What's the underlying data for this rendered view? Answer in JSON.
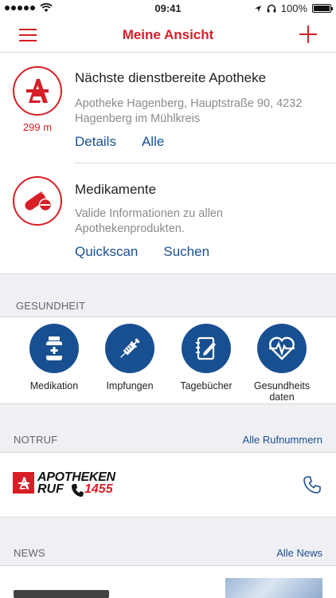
{
  "status_bar": {
    "time": "09:41",
    "battery": "100%"
  },
  "navbar": {
    "title": "Meine Ansicht",
    "menu_icon": "hamburger-icon",
    "add_icon": "plus-icon"
  },
  "pharmacy_card": {
    "icon": "apotheke-a-icon",
    "distance": "299 m",
    "title": "Nächste dienstbereite Apotheke",
    "address": "Apotheke Hagenberg, Hauptstraße 90, 4232 Hagenberg im Mühlkreis",
    "links": [
      "Details",
      "Alle"
    ]
  },
  "medication_card": {
    "icon": "pill-icon",
    "title": "Medikamente",
    "description": "Valide Informationen zu allen Apothekenprodukten.",
    "links": [
      "Quickscan",
      "Suchen"
    ]
  },
  "health_section": {
    "header": "GESUNDHEIT",
    "items": [
      {
        "label": "Medikation",
        "icon": "pill-bottle-icon"
      },
      {
        "label": "Impfungen",
        "icon": "syringe-icon"
      },
      {
        "label": "Tagebücher",
        "icon": "notebook-icon"
      },
      {
        "label": "Gesundheits daten",
        "icon": "heart-pulse-icon"
      }
    ]
  },
  "notruf_section": {
    "header": "NOTRUF",
    "link": "Alle Rufnummern",
    "logo_text_1": "APOTHEKEN",
    "logo_text_2": "RUF",
    "logo_number": "1455",
    "call_icon": "phone-icon"
  },
  "news_section": {
    "header": "NEWS",
    "link": "Alle News"
  },
  "colors": {
    "brand_red": "#d61f26",
    "link_blue": "#1b4f8f",
    "icon_blue": "#184f91",
    "section_gray": "#efeff4"
  }
}
